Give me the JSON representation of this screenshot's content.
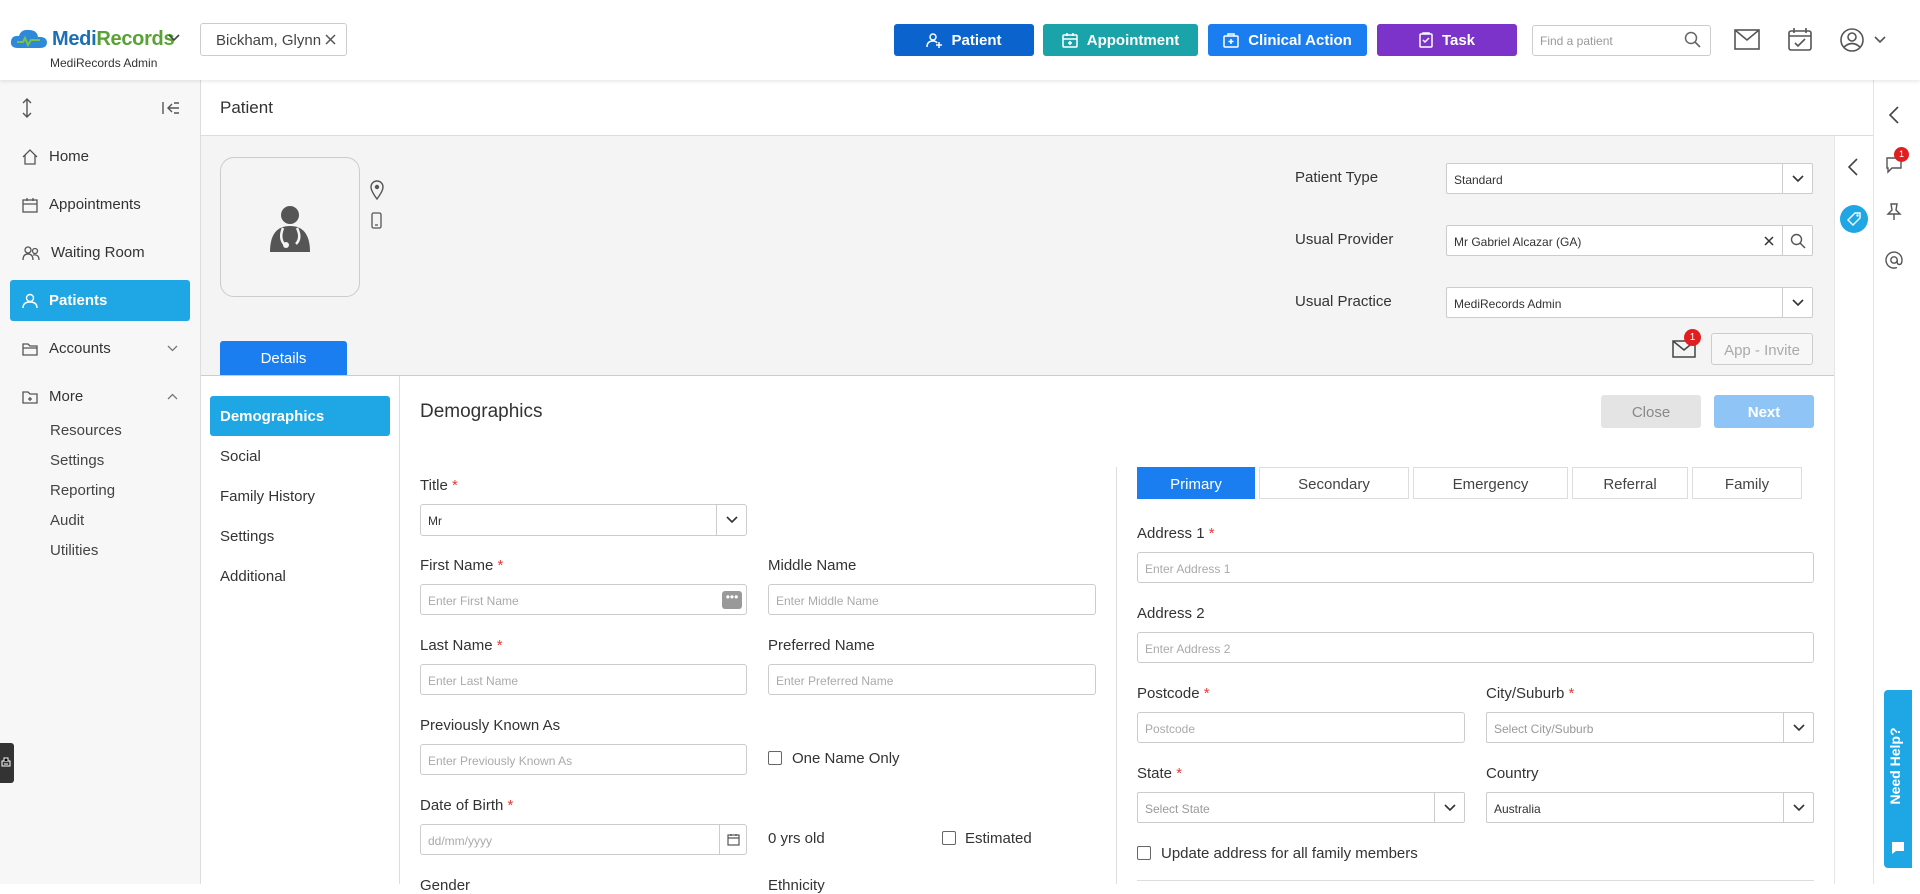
{
  "app": {
    "logo_main": "Medi",
    "logo_accent": "Records",
    "practice": "MediRecords Admin"
  },
  "patient_tab": {
    "name": "Bickham, Glynn"
  },
  "toolbar": {
    "buttons": [
      {
        "label": "Patient",
        "color": "#0b63ce"
      },
      {
        "label": "Appointment",
        "color": "#1aa3a8"
      },
      {
        "label": "Clinical Action",
        "color": "#1a7ef0"
      },
      {
        "label": "Task",
        "color": "#7b33c9"
      }
    ],
    "search_placeholder": "Find a patient"
  },
  "sidebar": {
    "items": [
      {
        "label": "Home",
        "icon": "home-icon"
      },
      {
        "label": "Appointments",
        "icon": "calendar-icon"
      },
      {
        "label": "Waiting Room",
        "icon": "people-icon"
      },
      {
        "label": "Patients",
        "icon": "person-icon",
        "active": true
      },
      {
        "label": "Accounts",
        "icon": "folder-icon"
      },
      {
        "label": "More",
        "icon": "folder-plus-icon"
      }
    ],
    "more_items": [
      "Resources",
      "Settings",
      "Reporting",
      "Audit",
      "Utilities"
    ]
  },
  "page": {
    "title": "Patient"
  },
  "patient_header": {
    "patient_type_label": "Patient Type",
    "patient_type_value": "Standard",
    "usual_provider_label": "Usual Provider",
    "usual_provider_value": "Mr Gabriel Alcazar (GA)",
    "usual_practice_label": "Usual Practice",
    "usual_practice_value": "MediRecords Admin",
    "invite_label": "App - Invite",
    "mail_badge": "1",
    "details_tab": "Details"
  },
  "left_menu": [
    "Demographics",
    "Social",
    "Family History",
    "Settings",
    "Additional"
  ],
  "form": {
    "heading": "Demographics",
    "close_label": "Close",
    "next_label": "Next",
    "title_label": "Title",
    "title_value": "Mr",
    "first_name_label": "First Name",
    "first_name_placeholder": "Enter First Name",
    "middle_name_label": "Middle Name",
    "middle_name_placeholder": "Enter Middle Name",
    "last_name_label": "Last Name",
    "last_name_placeholder": "Enter Last Name",
    "preferred_name_label": "Preferred Name",
    "preferred_name_placeholder": "Enter Preferred Name",
    "pka_label": "Previously Known As",
    "pka_placeholder": "Enter Previously Known As",
    "one_name_only": "One Name Only",
    "dob_label": "Date of Birth",
    "dob_placeholder": "dd/mm/yyyy",
    "age_text": "0 yrs old",
    "estimated": "Estimated",
    "gender_label": "Gender",
    "ethnicity_label": "Ethnicity"
  },
  "address": {
    "tabs": [
      "Primary",
      "Secondary",
      "Emergency",
      "Referral",
      "Family"
    ],
    "address1_label": "Address 1",
    "address1_placeholder": "Enter Address 1",
    "address2_label": "Address 2",
    "address2_placeholder": "Enter Address 2",
    "postcode_label": "Postcode",
    "postcode_placeholder": "Postcode",
    "city_label": "City/Suburb",
    "city_placeholder": "Select City/Suburb",
    "state_label": "State",
    "state_placeholder": "Select State",
    "country_label": "Country",
    "country_value": "Australia",
    "update_family": "Update address for all family members"
  },
  "right_rail": {
    "notification_badge": "1",
    "help_label": "Need Help?"
  }
}
